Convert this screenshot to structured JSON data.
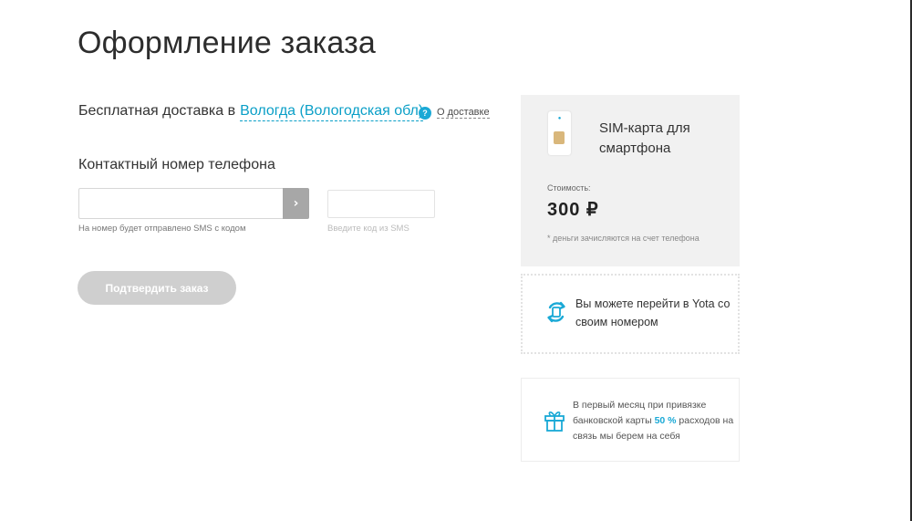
{
  "page": {
    "title": "Оформление заказа"
  },
  "delivery": {
    "prefix": "Бесплатная доставка в",
    "city": "Вологда (Вологодская обл)",
    "info_badge": "?",
    "info_link": "О доставке"
  },
  "contact": {
    "label": "Контактный номер телефона",
    "phone_value": "",
    "submit_icon": "chevron-right",
    "submit_glyph": "›",
    "phone_hint": "На номер будет отправлено SMS с кодом",
    "sms_value": "",
    "sms_hint": "Введите код из SMS"
  },
  "confirm": {
    "label": "Подтвердить заказ"
  },
  "product": {
    "title": "SIM-карта для смартфона",
    "price_label": "Стоимость:",
    "price": "300 ₽",
    "note": "* деньги зачисляются на счет телефона"
  },
  "transfer": {
    "text": "Вы можете перейти в Yota со своим номером",
    "icon": "number-transfer-icon"
  },
  "promo": {
    "icon": "gift-icon",
    "text_before": "В первый месяц при привязке банковской карты",
    "highlight": "50 %",
    "text_after": "расходов на связь мы берем на себя"
  },
  "colors": {
    "accent": "#1aa9d6",
    "link": "#0a9fc7",
    "card_bg": "#f1f1f1",
    "button_disabled": "#cfcfcf",
    "submit_bg": "#a7a7a7"
  }
}
